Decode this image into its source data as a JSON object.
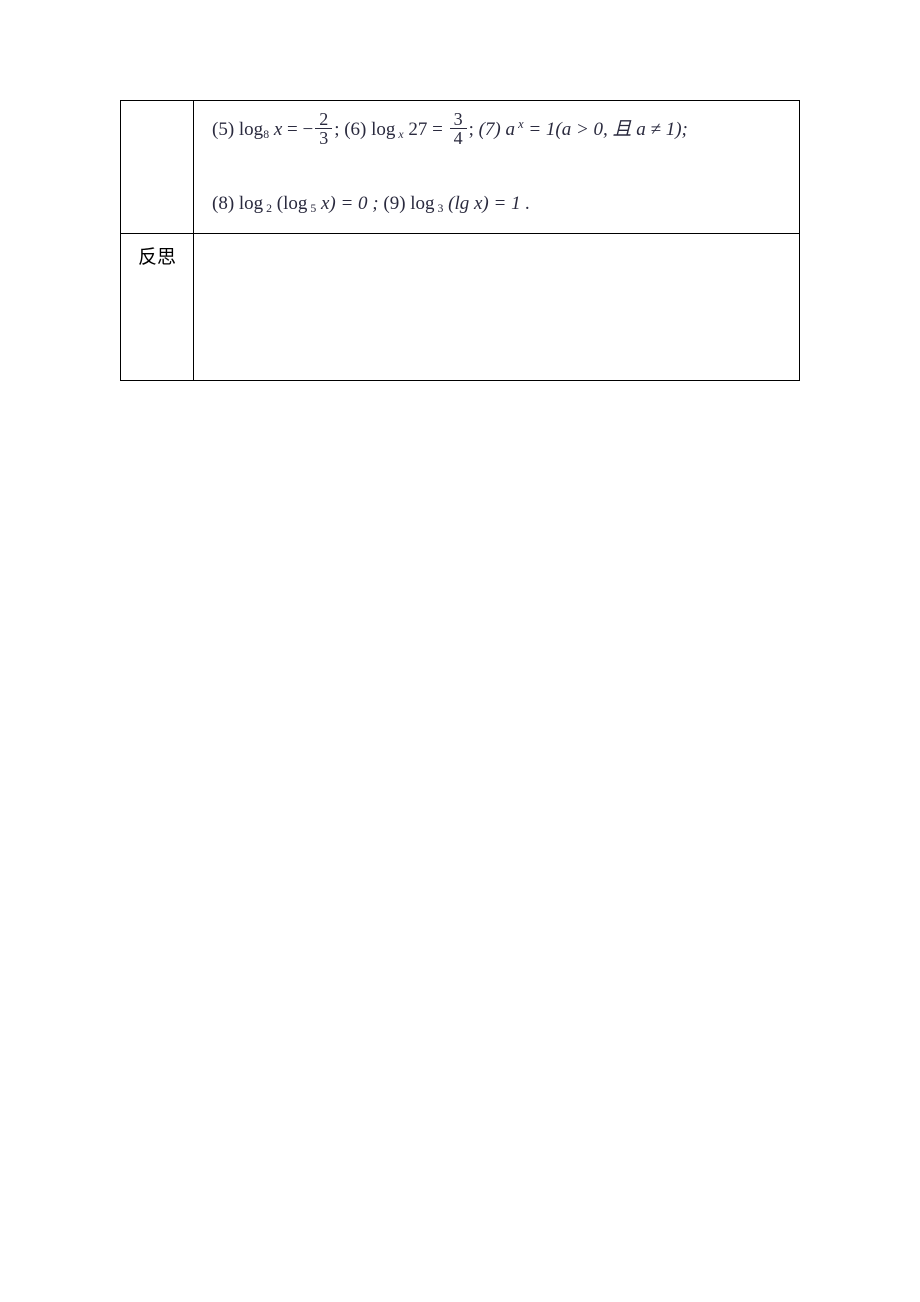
{
  "table": {
    "row1": {
      "label": "",
      "eq5": {
        "prefix": "(5) log",
        "base": "8",
        "arg": " x",
        "eq": " = −",
        "frac_num": "2",
        "frac_den": "3",
        "suffix": ";"
      },
      "eq6": {
        "prefix": "(6) log",
        "base": " x",
        "arg": " 27",
        "eq": " = ",
        "frac_num": "3",
        "frac_den": "4",
        "suffix": ";"
      },
      "eq7": {
        "prefix": "(7) a",
        "exp": " x",
        "rest": " = 1(a > 0, 且 a ≠ 1);"
      },
      "eq8": {
        "prefix": "(8) log",
        "base1": " 2",
        "mid": " (log",
        "base2": " 5",
        "rest": " x) = 0 ;"
      },
      "eq9": {
        "prefix": "(9) log",
        "base": " 3",
        "rest": " (lg x) = 1 ."
      }
    },
    "row2": {
      "label": "反思",
      "content": ""
    }
  }
}
